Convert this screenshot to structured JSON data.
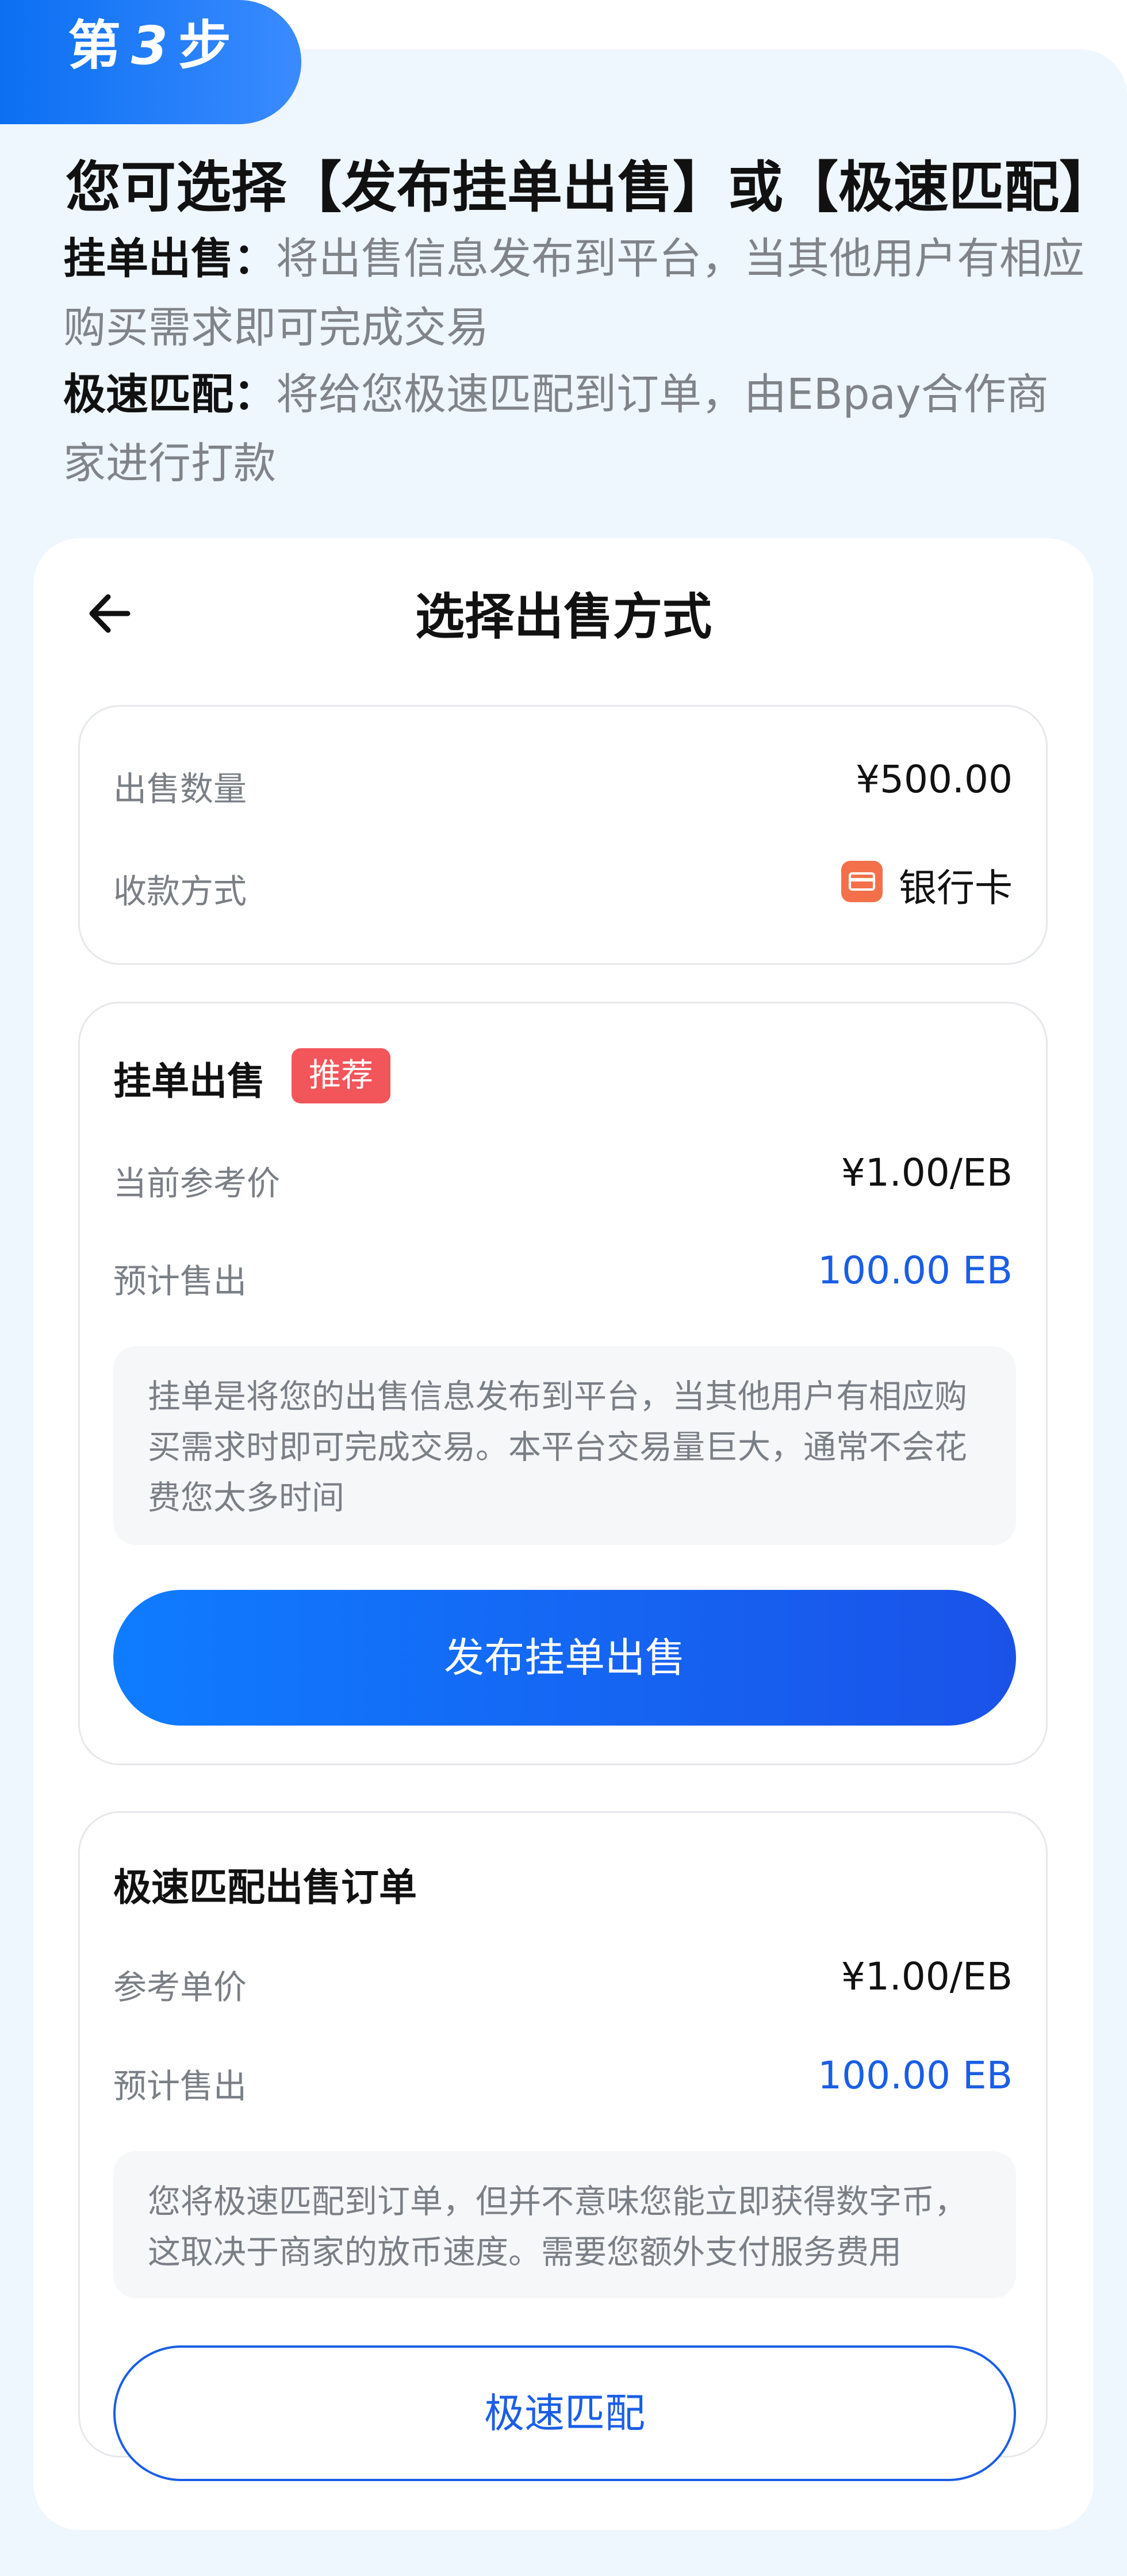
{
  "step": {
    "prefix": "第",
    "number": "3",
    "suffix": "步"
  },
  "headline": "您可选择【发布挂单出售】或【极速匹配】",
  "intro": [
    {
      "term": "挂单出售：",
      "text": "将出售信息发布到平台，当其他用户有相应购买需求即可完成交易"
    },
    {
      "term": "极速匹配：",
      "text": "将给您极速匹配到订单，由EBpay合作商家进行打款"
    }
  ],
  "screen": {
    "title": "选择出售方式",
    "summary": {
      "amount_label": "出售数量",
      "amount_value": "¥500.00",
      "method_label": "收款方式",
      "method_value": "银行卡",
      "method_icon": "bank-card-icon"
    },
    "listing": {
      "title": "挂单出售",
      "tag": "推荐",
      "price_label": "当前参考价",
      "price_value": "¥1.00/EB",
      "est_label": "预计售出",
      "est_value": "100.00 EB",
      "note": "挂单是将您的出售信息发布到平台，当其他用户有相应购买需求时即可完成交易。本平台交易量巨大，通常不会花费您太多时间",
      "button": "发布挂单出售"
    },
    "quick": {
      "title": "极速匹配出售订单",
      "price_label": "参考单价",
      "price_value": "¥1.00/EB",
      "est_label": "预计售出",
      "est_value": "100.00 EB",
      "note": "您将极速匹配到订单，但并不意味您能立即获得数字币，这取决于商家的放币速度。需要您额外支付服务费用",
      "button": "极速匹配"
    }
  },
  "colors": {
    "accent": "#1a5ee6",
    "tag": "#f2555a",
    "background": "#eef6fe"
  }
}
